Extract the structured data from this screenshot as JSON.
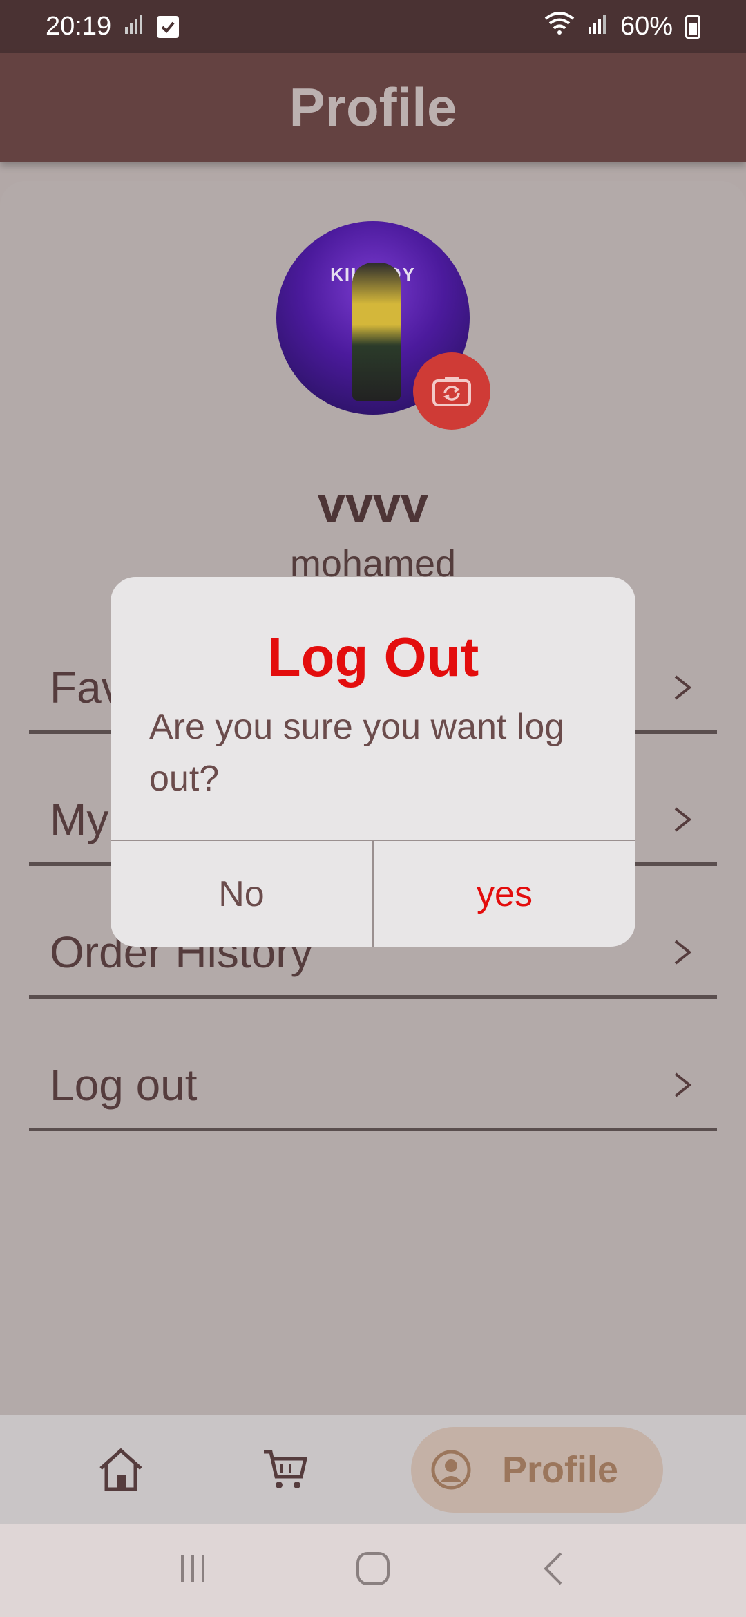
{
  "status_bar": {
    "time": "20:19",
    "battery": "60%"
  },
  "app_bar": {
    "title": "Profile"
  },
  "profile": {
    "avatar_logo": "KILLJOY",
    "name": "vvvv",
    "subtitle": "mohamed"
  },
  "menu": {
    "items": [
      {
        "label": "Favorites"
      },
      {
        "label": "My Orders"
      },
      {
        "label": "Order History"
      },
      {
        "label": "Log out"
      }
    ]
  },
  "dialog": {
    "title": "Log Out",
    "message": "Are you sure you want log out?",
    "no_label": "No",
    "yes_label": "yes"
  },
  "bottom_nav": {
    "profile_label": "Profile"
  },
  "colors": {
    "accent_red": "#e30d0d",
    "app_bar": "#644241",
    "nav_profile_pill": "#c4b1a6"
  }
}
